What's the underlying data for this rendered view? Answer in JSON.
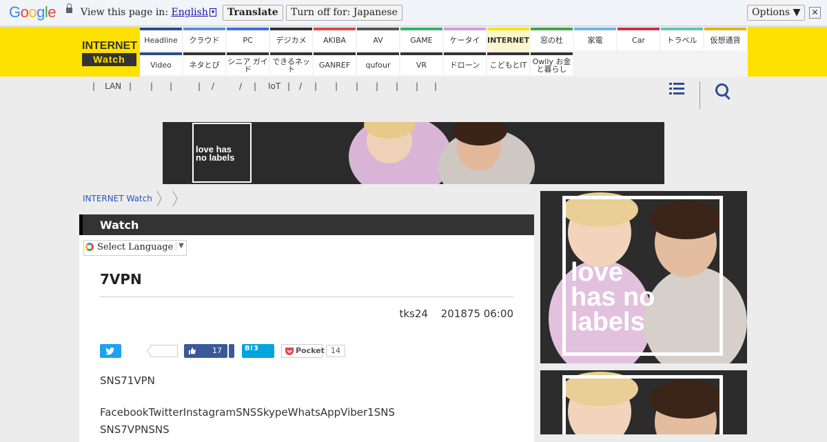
{
  "translate_bar": {
    "logo_letters": [
      "G",
      "o",
      "o",
      "g",
      "l",
      "e"
    ],
    "logo_colors": [
      "#4285f4",
      "#ea4335",
      "#fbbc05",
      "#4285f4",
      "#34a853",
      "#ea4335"
    ],
    "prompt": "View this page in:",
    "language": "English",
    "dropdown_glyph": "▾",
    "translate_button": "Translate",
    "turn_off_button": "Turn off for: Japanese",
    "options_button": "Options ▼",
    "close_glyph": "✕"
  },
  "site": {
    "logo_top": "INTERNET",
    "logo_bottom": "Watch",
    "nav_row1": [
      {
        "label": "Headline",
        "color": "#2a4d8f"
      },
      {
        "label": "クラウド",
        "color": "#5b8fd1"
      },
      {
        "label": "PC",
        "color": "#3f6fd8"
      },
      {
        "label": "デジカメ",
        "color": "#333333"
      },
      {
        "label": "AKIBA",
        "color": "#e1454a"
      },
      {
        "label": "AV",
        "color": "#555555"
      },
      {
        "label": "GAME",
        "color": "#31b36a"
      },
      {
        "label": "ケータイ",
        "color": "#d49ad6"
      },
      {
        "label": "INTERNET",
        "color": "#ffe100",
        "active": true
      },
      {
        "label": "窓の杜",
        "color": "#41a54a"
      },
      {
        "label": "家電",
        "color": "#6fb6e8"
      },
      {
        "label": "Car",
        "color": "#c8304a"
      },
      {
        "label": "トラベル",
        "color": "#63c5b0"
      },
      {
        "label": "仮想通貨",
        "color": "#e8b200"
      }
    ],
    "nav_row2": [
      {
        "label": "Video",
        "color": "#2a4d8f"
      },
      {
        "label": "ネタとぴ",
        "color": "#333333"
      },
      {
        "label": "シニア ガイド",
        "color": "#333333"
      },
      {
        "label": "できるネット",
        "color": "#333333"
      },
      {
        "label": "GANREF",
        "color": "#333333"
      },
      {
        "label": "qufour",
        "color": "#333333"
      },
      {
        "label": "VR",
        "color": "#333333"
      },
      {
        "label": "ドローン",
        "color": "#333333"
      },
      {
        "label": "こどもとIT",
        "color": "#333333"
      },
      {
        "label": "Owlly お金と暮らし",
        "color": "#333333"
      }
    ],
    "subnav": [
      "|",
      "LAN",
      "|",
      "|",
      "|",
      "|",
      "/",
      "/",
      "|",
      "IoT",
      "|",
      "/",
      "|",
      "|",
      "|",
      "|",
      "|",
      "|",
      "|"
    ]
  },
  "ads": {
    "banner_text": "love has no labels",
    "side_text": "love has no labels"
  },
  "breadcrumb": {
    "home": "INTERNET Watch"
  },
  "article": {
    "section": "Watch",
    "language_select": "Select Language",
    "language_arrow": "▼",
    "title": "7VPN",
    "author": "tks24",
    "date": "201875 06:00",
    "share": {
      "facebook_count": "17",
      "hatena_label": "B!",
      "hatena_count": "3",
      "pocket_label": "Pocket",
      "pocket_count": "14"
    },
    "paragraphs": [
      "SNS71VPN",
      "FacebookTwitterInstagramSNSSkypeWhatsAppViber1SNS",
      "SNS7VPNSNS"
    ]
  }
}
